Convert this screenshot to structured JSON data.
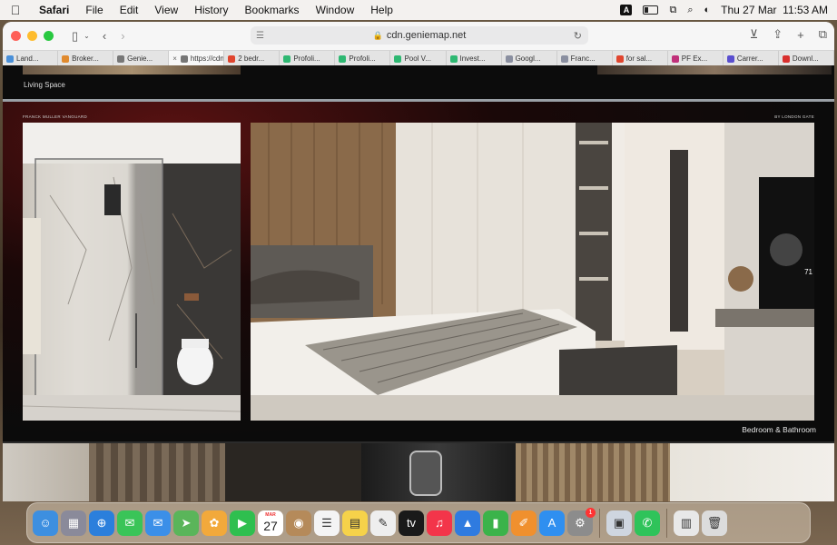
{
  "menubar": {
    "app": "Safari",
    "items": [
      "File",
      "Edit",
      "View",
      "History",
      "Bookmarks",
      "Window",
      "Help"
    ],
    "input_badge": "A",
    "datetime": "Thu 27 Mar  11:53 AM"
  },
  "browser": {
    "url": "cdn.geniemap.net",
    "tabs": [
      {
        "title": "Land...",
        "color": "#4a90d9"
      },
      {
        "title": "Broker...",
        "color": "#e08a2e"
      },
      {
        "title": "Genie...",
        "color": "#777777"
      },
      {
        "title": "https://cdn...",
        "color": "#777777",
        "active": true
      },
      {
        "title": "2 bedr...",
        "color": "#e0452e"
      },
      {
        "title": "Profoli...",
        "color": "#2eb872"
      },
      {
        "title": "Profoli...",
        "color": "#2eb872"
      },
      {
        "title": "Pool V...",
        "color": "#2eb872"
      },
      {
        "title": "Invest...",
        "color": "#2eb872"
      },
      {
        "title": "Googl...",
        "color": "#8a8fa0"
      },
      {
        "title": "Franc...",
        "color": "#8a8fa0"
      },
      {
        "title": "for sal...",
        "color": "#e0452e"
      },
      {
        "title": "PF Ex...",
        "color": "#c0307a"
      },
      {
        "title": "Carrer...",
        "color": "#5a4fcf"
      },
      {
        "title": "Downl...",
        "color": "#d9302e"
      }
    ]
  },
  "page": {
    "top_caption": "Living Space",
    "brand_left": "FRANCK MULLER VANGUARD",
    "brand_right": "BY LONDON GATE",
    "main_caption": "Bedroom & Bathroom",
    "side_number": "71"
  },
  "dock": {
    "apps": [
      {
        "name": "finder",
        "color": "#3d8fe0",
        "glyph": "☺"
      },
      {
        "name": "launchpad",
        "color": "#8a8a9a",
        "glyph": "▦"
      },
      {
        "name": "safari",
        "color": "#2b7fdc",
        "glyph": "⊕"
      },
      {
        "name": "messages",
        "color": "#3ac458",
        "glyph": "✉"
      },
      {
        "name": "mail",
        "color": "#3b8fe8",
        "glyph": "✉"
      },
      {
        "name": "maps",
        "color": "#5ab55a",
        "glyph": "➤"
      },
      {
        "name": "photos",
        "color": "#f2a93b",
        "glyph": "✿"
      },
      {
        "name": "facetime",
        "color": "#2fbf4f",
        "glyph": "▶"
      },
      {
        "name": "calendar",
        "color": "#ffffff",
        "glyph": "27",
        "month": "MAR"
      },
      {
        "name": "contacts",
        "color": "#b58a5a",
        "glyph": "◉"
      },
      {
        "name": "reminders",
        "color": "#f4f4f4",
        "glyph": "☰"
      },
      {
        "name": "notes",
        "color": "#f6d24a",
        "glyph": "▤"
      },
      {
        "name": "freeform",
        "color": "#eeeeee",
        "glyph": "✎"
      },
      {
        "name": "tv",
        "color": "#1a1a1a",
        "glyph": "tv"
      },
      {
        "name": "music",
        "color": "#f3354a",
        "glyph": "♫"
      },
      {
        "name": "keynote",
        "color": "#2f7be0",
        "glyph": "▲"
      },
      {
        "name": "numbers",
        "color": "#3bb34a",
        "glyph": "▮"
      },
      {
        "name": "pages",
        "color": "#f0902e",
        "glyph": "✐"
      },
      {
        "name": "app-store",
        "color": "#2f8ff0",
        "glyph": "A"
      },
      {
        "name": "system-settings",
        "color": "#8c8c8c",
        "glyph": "⚙",
        "badge": "1"
      }
    ],
    "extras": [
      {
        "name": "preview",
        "color": "#cfd6e0",
        "glyph": "▣"
      },
      {
        "name": "whatsapp",
        "color": "#2fc35a",
        "glyph": "✆"
      }
    ],
    "right": [
      {
        "name": "downloads-stack",
        "color": "#e8e8e8",
        "glyph": "▥"
      },
      {
        "name": "trash",
        "color": "#dcdcdc",
        "glyph": "🗑"
      }
    ]
  }
}
